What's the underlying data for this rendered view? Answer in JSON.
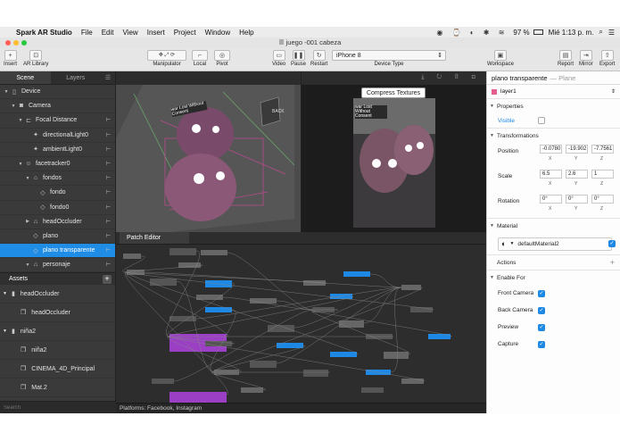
{
  "menubar": {
    "apple": "",
    "items": [
      "Spark AR Studio",
      "File",
      "Edit",
      "View",
      "Insert",
      "Project",
      "Window",
      "Help"
    ],
    "status": {
      "battery": "97 %",
      "clock": "Mié 1:13 p. m."
    }
  },
  "window": {
    "title": "juego -001 cabeza"
  },
  "toolbar": {
    "insert": "Insert",
    "library": "AR Library",
    "manipulator": "Manipulator",
    "local": "Local",
    "pivot": "Pivot",
    "video": "Video",
    "pause": "Pause",
    "restart": "Restart",
    "device_value": "iPhone 8",
    "device_label": "Device Type",
    "workspace": "Workspace",
    "report": "Report",
    "mirror": "Mirror",
    "export": "Export"
  },
  "scene_panel": {
    "tabs": [
      "Scene",
      "Layers"
    ],
    "rows": [
      {
        "label": "Device",
        "icon": "device-icon",
        "depth": 0,
        "exp": "▼"
      },
      {
        "label": "Camera",
        "icon": "camera-icon",
        "depth": 1,
        "exp": "▼"
      },
      {
        "label": "Focal Distance",
        "icon": "focal-icon",
        "depth": 2,
        "exp": "▼"
      },
      {
        "label": "directionalLight0",
        "icon": "light-icon",
        "depth": 3,
        "exp": ""
      },
      {
        "label": "ambientLight0",
        "icon": "light-icon",
        "depth": 3,
        "exp": ""
      },
      {
        "label": "facetracker0",
        "icon": "face-icon",
        "depth": 2,
        "exp": "▼"
      },
      {
        "label": "fondos",
        "icon": "null-icon",
        "depth": 3,
        "exp": "▼"
      },
      {
        "label": "fondo",
        "icon": "plane-icon",
        "depth": 4,
        "exp": ""
      },
      {
        "label": "fondo0",
        "icon": "plane-icon",
        "depth": 4,
        "exp": ""
      },
      {
        "label": "headOccluder",
        "icon": "null-icon",
        "depth": 3,
        "exp": "▶"
      },
      {
        "label": "plano",
        "icon": "plane-icon",
        "depth": 3,
        "exp": ""
      },
      {
        "label": "plano transparente",
        "icon": "plane-icon",
        "depth": 3,
        "exp": "",
        "selected": true
      },
      {
        "label": "personaje",
        "icon": "null-icon",
        "depth": 3,
        "exp": "▼"
      }
    ]
  },
  "assets": {
    "title": "Assets",
    "items": [
      {
        "label": "headOccluder",
        "depth": 0,
        "exp": "▼"
      },
      {
        "label": "headOccluder",
        "depth": 1,
        "exp": ""
      },
      {
        "label": "niña2",
        "depth": 0,
        "exp": "▼"
      },
      {
        "label": "niña2",
        "depth": 1,
        "exp": ""
      },
      {
        "label": "CINEMA_4D_Principal",
        "depth": 1,
        "exp": ""
      },
      {
        "label": "Mat.2",
        "depth": 1,
        "exp": ""
      }
    ],
    "search_placeholder": "Search"
  },
  "viewport": {
    "back_label": "BACK",
    "compress_button": "Compress Textures",
    "sticker_text": "war Lost Without Consent"
  },
  "patch_editor": {
    "tab": "Patch Editor",
    "platforms": "Platforms: Facebook, Instagram"
  },
  "inspector": {
    "object_name": "plano transparente",
    "object_type": "— Plane",
    "layer": "layer1",
    "properties_label": "Properties",
    "visible_label": "Visible",
    "transformations_label": "Transformations",
    "position_label": "Position",
    "position": [
      "-0.0780",
      "-19.902",
      "-7.7561"
    ],
    "scale_label": "Scale",
    "scale": [
      "6.5",
      "2.6",
      "1"
    ],
    "rotation_label": "Rotation",
    "rotation": [
      "0°",
      "0°",
      "0°"
    ],
    "axes": [
      "X",
      "Y",
      "Z"
    ],
    "material_label": "Material",
    "material": "defaultMaterial2",
    "actions_label": "Actions",
    "enable_label": "Enable For",
    "enable": [
      "Front Camera",
      "Back Camera",
      "Preview",
      "Capture"
    ]
  },
  "colors": {
    "accent": "#1f8ce6",
    "layer_swatch": "#e35d8f"
  }
}
